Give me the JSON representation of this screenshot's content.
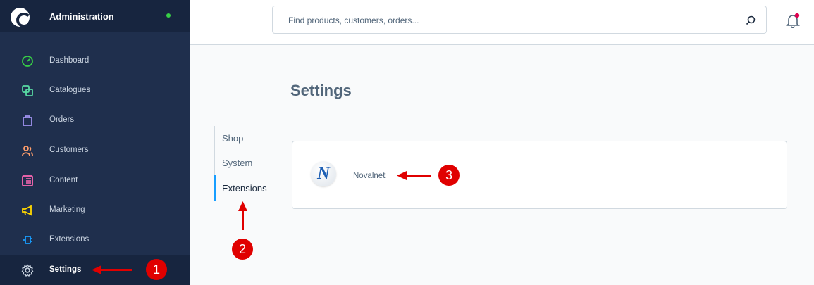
{
  "sidebar": {
    "title": "Administration",
    "items": [
      {
        "label": "Dashboard",
        "icon": "dashboard-icon",
        "color": "#37d046"
      },
      {
        "label": "Catalogues",
        "icon": "catalogues-icon",
        "color": "#57d9a3"
      },
      {
        "label": "Orders",
        "icon": "orders-icon",
        "color": "#a092f0"
      },
      {
        "label": "Customers",
        "icon": "customers-icon",
        "color": "#ff9e6b"
      },
      {
        "label": "Content",
        "icon": "content-icon",
        "color": "#ff68b4"
      },
      {
        "label": "Marketing",
        "icon": "marketing-icon",
        "color": "#ffd700"
      },
      {
        "label": "Extensions",
        "icon": "extensions-icon",
        "color": "#189eff"
      },
      {
        "label": "Settings",
        "icon": "settings-icon",
        "color": "#c9d3e0"
      }
    ]
  },
  "search": {
    "placeholder": "Find products, customers, orders..."
  },
  "page": {
    "title": "Settings"
  },
  "submenu": {
    "items": [
      "Shop",
      "System",
      "Extensions"
    ],
    "active": "Extensions"
  },
  "extension": {
    "name": "Novalnet",
    "logo_letter": "N"
  },
  "annotations": {
    "one": "1",
    "two": "2",
    "three": "3"
  },
  "colors": {
    "sidebar_bg": "#1f2f4d",
    "accent": "#189eff",
    "annotation_red": "#e00000"
  }
}
